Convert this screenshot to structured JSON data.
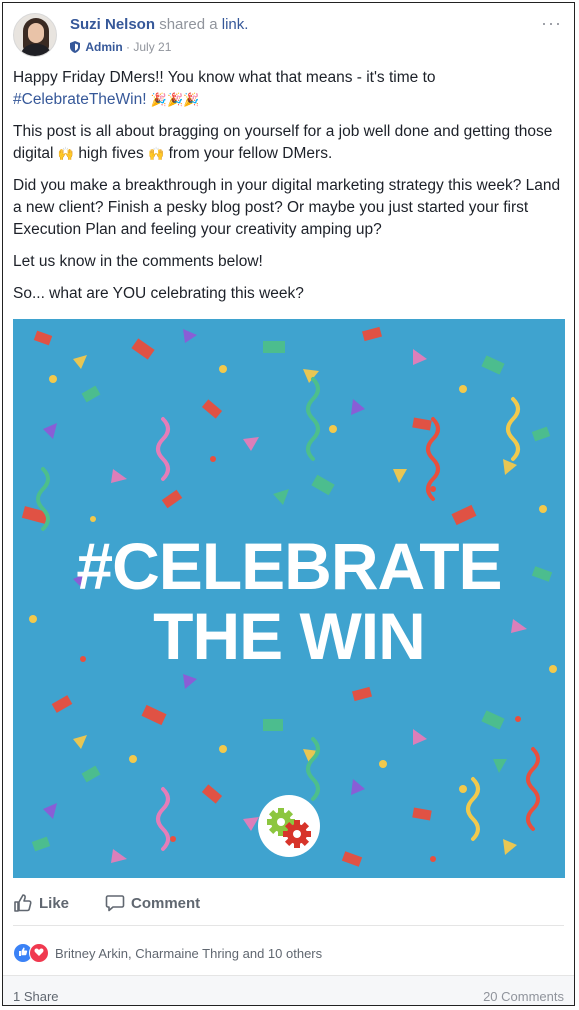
{
  "post": {
    "author": "Suzi Nelson",
    "verb": "shared a",
    "verb_object": "link.",
    "role": "Admin",
    "separator": " · ",
    "date": "July 21",
    "more_label": "···",
    "paragraphs": {
      "p1_a": "Happy Friday DMers!! You know what that means - it's time to",
      "p1_hashtag": "#CelebrateTheWin!",
      "p1_emoji": "🎉🎉🎉",
      "p2_a": "This post is all about bragging on yourself for a job well done and getting those digital",
      "p2_emoji1": "🙌",
      "p2_b": "high fives",
      "p2_emoji2": "🙌",
      "p2_c": "from your fellow DMers.",
      "p3": "Did you make a breakthrough in your digital marketing strategy this week? Land a new client? Finish a pesky blog post? Or maybe you just started your first Execution Plan and feeling your creativity amping up?",
      "p4": "Let us know in the comments below!",
      "p5": "So... what are YOU celebrating this week?"
    },
    "image": {
      "line1": "#CELEBRATE",
      "line2": "THE WIN",
      "background": "#3fa3cf"
    }
  },
  "actions": {
    "like": "Like",
    "comment": "Comment"
  },
  "reactions": {
    "text": "Britney Arkin, Charmaine Thring and 10 others",
    "like_color": "#3b82f6",
    "love_color": "#f0394f"
  },
  "footer": {
    "shares": "1 Share",
    "comments": "20 Comments"
  },
  "icons": {
    "admin_shield": "shield-icon",
    "like": "thumbs-up-icon",
    "comment": "comment-bubble-icon",
    "logo": "gears-logo"
  }
}
